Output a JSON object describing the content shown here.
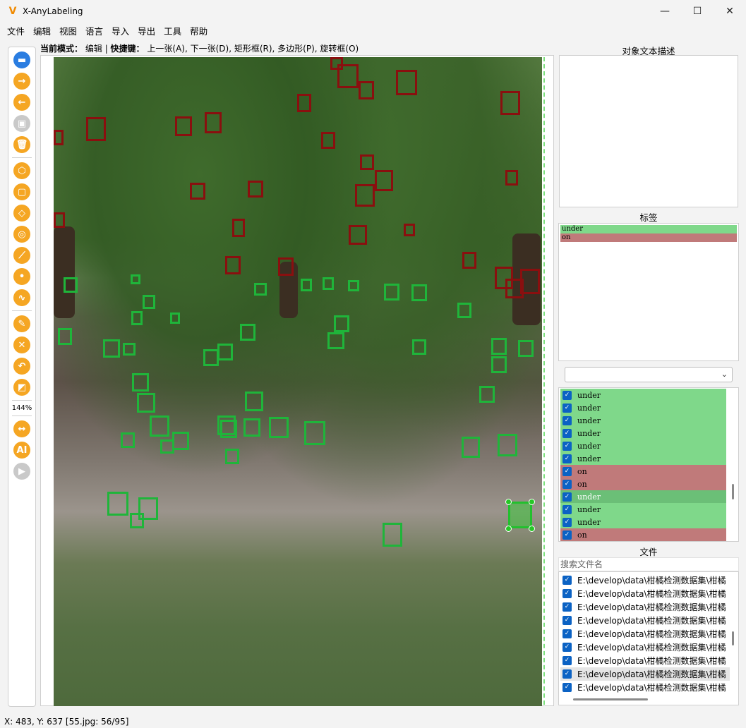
{
  "window": {
    "title": "X-AnyLabeling",
    "minimize": "—",
    "maximize": "☐",
    "close": "✕"
  },
  "menu": [
    "文件",
    "编辑",
    "视图",
    "语言",
    "导入",
    "导出",
    "工具",
    "帮助"
  ],
  "toolbar": {
    "zoom": "144%"
  },
  "mode_bar": {
    "label": "当前模式：",
    "mode": "编辑",
    "shortcut_label": "快捷键：",
    "shortcuts": "上一张(A), 下一张(D), 矩形框(R), 多边形(P), 旋转框(O)"
  },
  "panels": {
    "description_title": "对象文本描述",
    "labels_title": "标签",
    "files_title": "文件",
    "search_placeholder": "搜索文件名"
  },
  "colors": {
    "under": "#7fd88a",
    "on": "#c07a7a",
    "under_selected": "#6bbf77"
  },
  "labels": [
    {
      "name": "under",
      "color": "#7fd88a"
    },
    {
      "name": "on",
      "color": "#c07a7a"
    }
  ],
  "shapes": [
    {
      "label": "under",
      "checked": true
    },
    {
      "label": "under",
      "checked": true
    },
    {
      "label": "under",
      "checked": true
    },
    {
      "label": "under",
      "checked": true
    },
    {
      "label": "under",
      "checked": true
    },
    {
      "label": "under",
      "checked": true
    },
    {
      "label": "on",
      "checked": true
    },
    {
      "label": "on",
      "checked": true
    },
    {
      "label": "under",
      "checked": true,
      "selected": true
    },
    {
      "label": "under",
      "checked": true
    },
    {
      "label": "under",
      "checked": true
    },
    {
      "label": "on",
      "checked": true
    }
  ],
  "files": [
    {
      "name": "E:\\develop\\data\\柑橘检测数据集\\柑橘",
      "checked": true
    },
    {
      "name": "E:\\develop\\data\\柑橘检测数据集\\柑橘",
      "checked": true
    },
    {
      "name": "E:\\develop\\data\\柑橘检测数据集\\柑橘",
      "checked": true
    },
    {
      "name": "E:\\develop\\data\\柑橘检测数据集\\柑橘",
      "checked": true
    },
    {
      "name": "E:\\develop\\data\\柑橘检测数据集\\柑橘",
      "checked": true
    },
    {
      "name": "E:\\develop\\data\\柑橘检测数据集\\柑橘",
      "checked": true
    },
    {
      "name": "E:\\develop\\data\\柑橘检测数据集\\柑橘",
      "checked": true
    },
    {
      "name": "E:\\develop\\data\\柑橘检测数据集\\柑橘",
      "checked": true,
      "active": true
    },
    {
      "name": "E:\\develop\\data\\柑橘检测数据集\\柑橘",
      "checked": true
    }
  ],
  "status": "X: 483, Y: 637 [55.jpg: 56/95]"
}
